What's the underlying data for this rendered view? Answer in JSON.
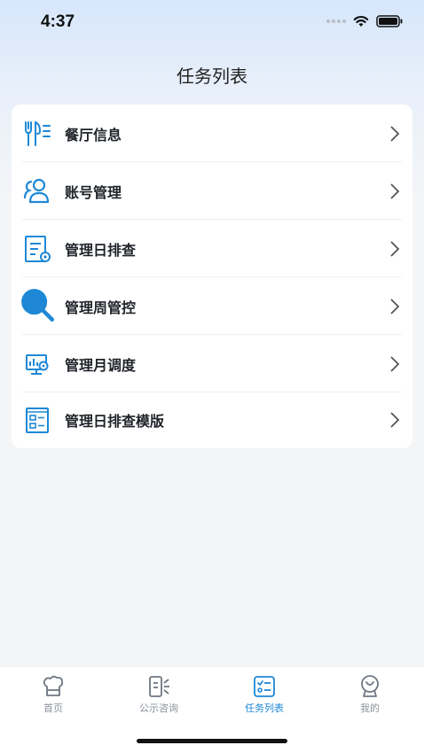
{
  "status_bar": {
    "time": "4:37"
  },
  "header": {
    "title": "任务列表"
  },
  "menu": {
    "items": [
      {
        "label": "餐厅信息",
        "icon": "restaurant-utensils-icon"
      },
      {
        "label": "账号管理",
        "icon": "users-icon"
      },
      {
        "label": "管理日排查",
        "icon": "document-gear-icon"
      },
      {
        "label": "管理周管控",
        "icon": "magnifier-icon"
      },
      {
        "label": "管理月调度",
        "icon": "monitor-gear-icon"
      },
      {
        "label": "管理日排查模版",
        "icon": "template-grid-icon"
      }
    ]
  },
  "tabbar": {
    "tabs": [
      {
        "label": "首页",
        "icon": "home-icon"
      },
      {
        "label": "公示咨询",
        "icon": "announcement-icon"
      },
      {
        "label": "任务列表",
        "icon": "task-list-icon",
        "active": true
      },
      {
        "label": "我的",
        "icon": "profile-icon"
      }
    ]
  },
  "colors": {
    "accent": "#1e88d6",
    "inactive": "#8b9199",
    "text": "#1f2329"
  }
}
